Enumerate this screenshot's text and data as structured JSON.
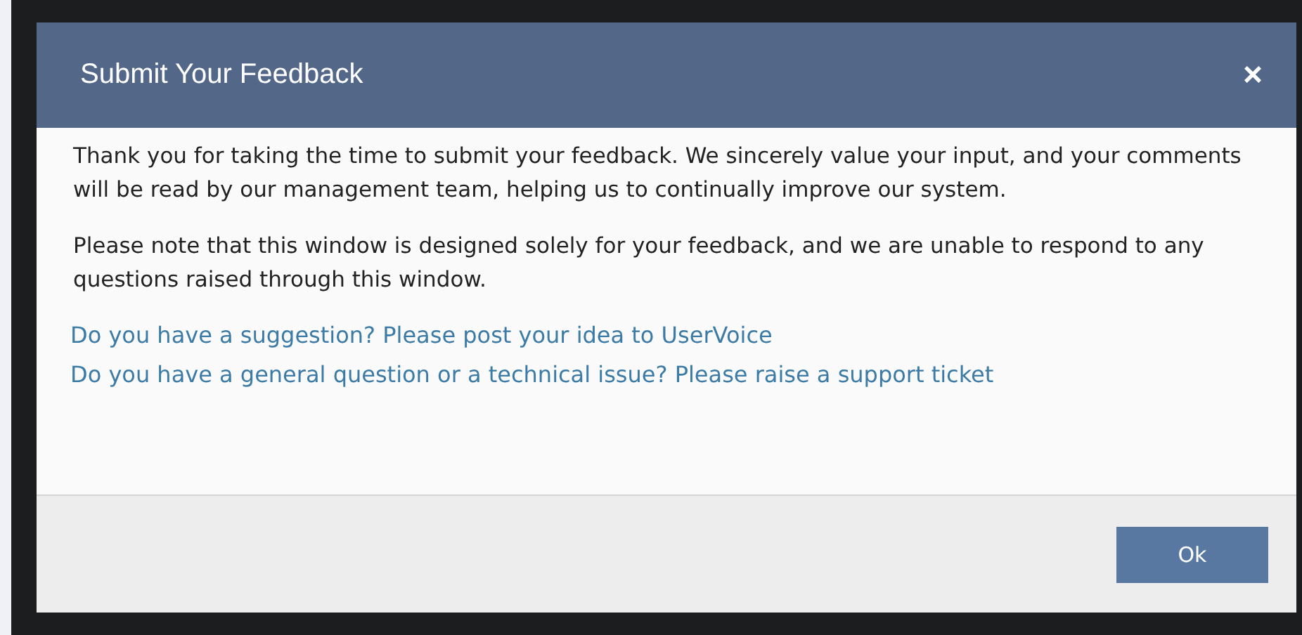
{
  "dialog": {
    "title": "Submit Your Feedback",
    "close": "×",
    "paragraphs": [
      "Thank you for taking the time to submit your feedback. We sincerely value your input, and your comments will be read by our management team, helping us to continually improve our system.",
      "Please note that this window is designed solely for your feedback, and we are unable to respond to any questions raised through this window."
    ],
    "links": [
      "Do you have a suggestion? Please post your idea to UserVoice",
      "Do you have a general question or a technical issue? Please raise a support ticket"
    ],
    "buttons": [
      "Ok"
    ]
  }
}
